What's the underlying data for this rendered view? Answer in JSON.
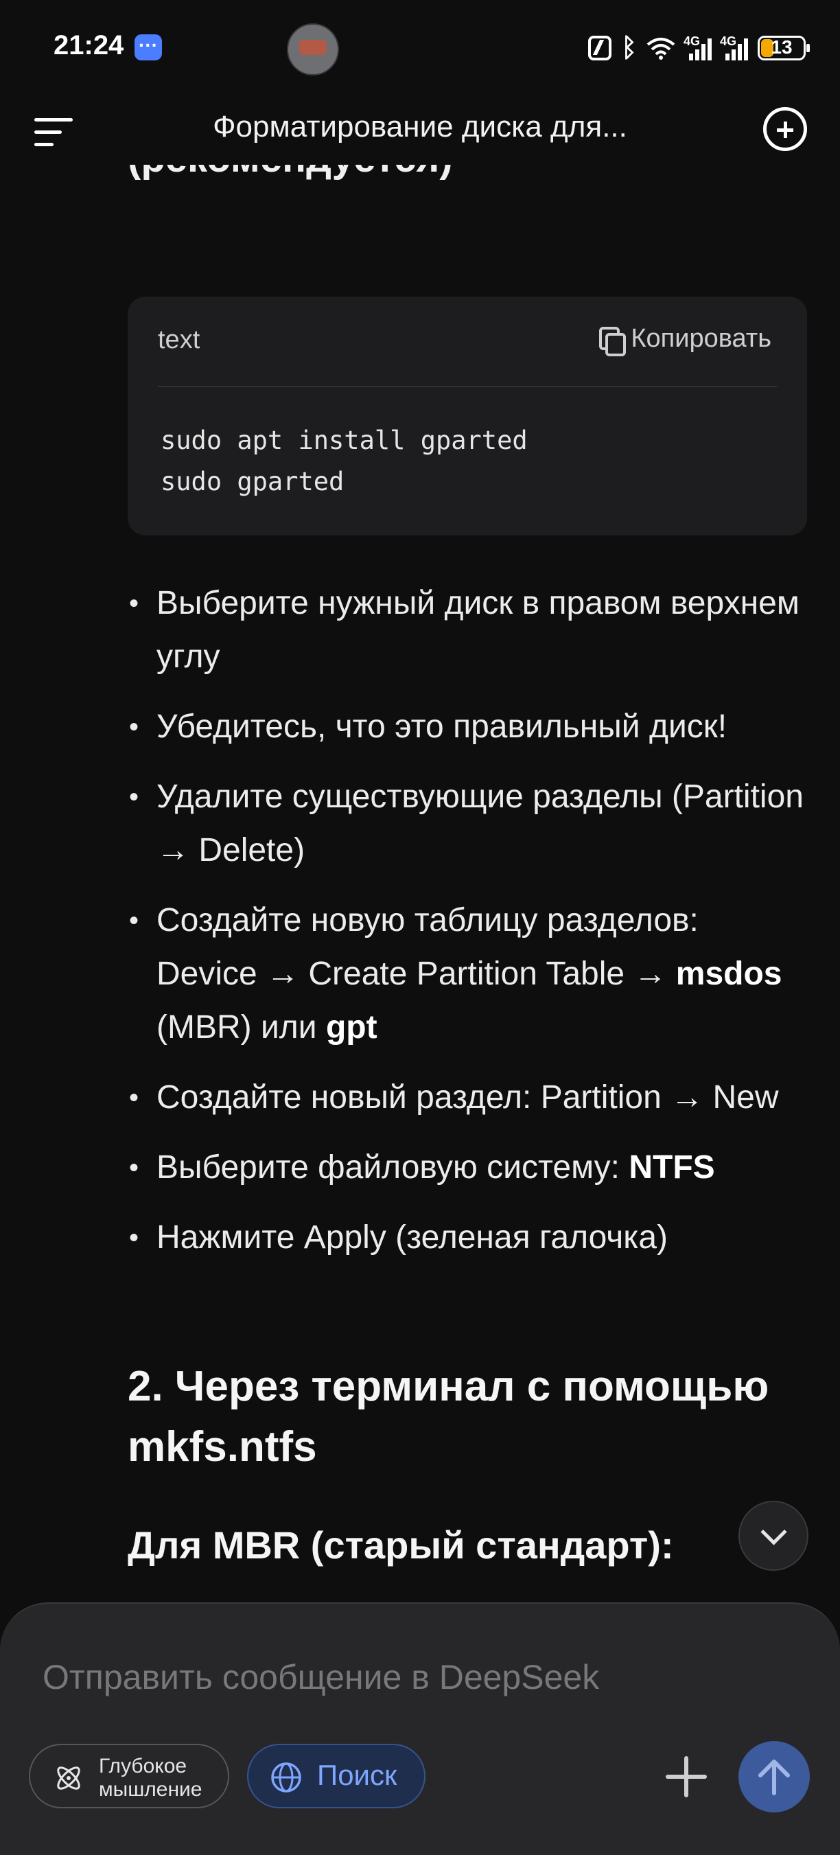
{
  "status_bar": {
    "time": "21:24",
    "network_1": "4G",
    "network_2": "4G",
    "battery": "13",
    "icons": [
      "message-icon",
      "nfc-icon",
      "bluetooth-icon",
      "wifi-icon",
      "signal-icon",
      "signal-icon",
      "battery-icon"
    ]
  },
  "header": {
    "title": "Форматирование диска для...",
    "menu_icon": "menu-icon",
    "new_chat_icon": "new-chat-icon"
  },
  "content": {
    "partial_heading": "(рекомендуется)",
    "code": {
      "lang": "text",
      "copy_label": "Копировать",
      "lines": "sudo apt install gparted\nsudo gparted"
    },
    "bullets": [
      {
        "text": "Выберите нужный диск в правом верхнем углу"
      },
      {
        "text": "Убедитесь, что это правильный диск!"
      },
      {
        "text": "Удалите существующие разделы (Partition → Delete)"
      },
      {
        "pre": "Создайте новую таблицу разделов: Device → Create Partition Table → ",
        "b1": "msdos",
        "mid": " (MBR) или ",
        "b2": "gpt"
      },
      {
        "text": "Создайте новый раздел: Partition → New"
      },
      {
        "pre": "Выберите файловую систему: ",
        "b1": "NTFS"
      },
      {
        "text": "Нажмите Apply (зеленая галочка)"
      }
    ],
    "h2": "2. Через терминал с помощью mkfs.ntfs",
    "h3": "Для MBR (старый стандарт):"
  },
  "composer": {
    "placeholder": "Отправить сообщение в DeepSeek",
    "deep_think_line1": "Глубокое",
    "deep_think_line2": "мышление",
    "search_label": "Поиск"
  },
  "colors": {
    "background": "#0e0e0f",
    "code_bg": "#1d1d1f",
    "composer_bg": "#27272a",
    "accent": "#7ea6ff",
    "send_button": "#3c5a9c",
    "battery_fill": "#f2a900"
  }
}
